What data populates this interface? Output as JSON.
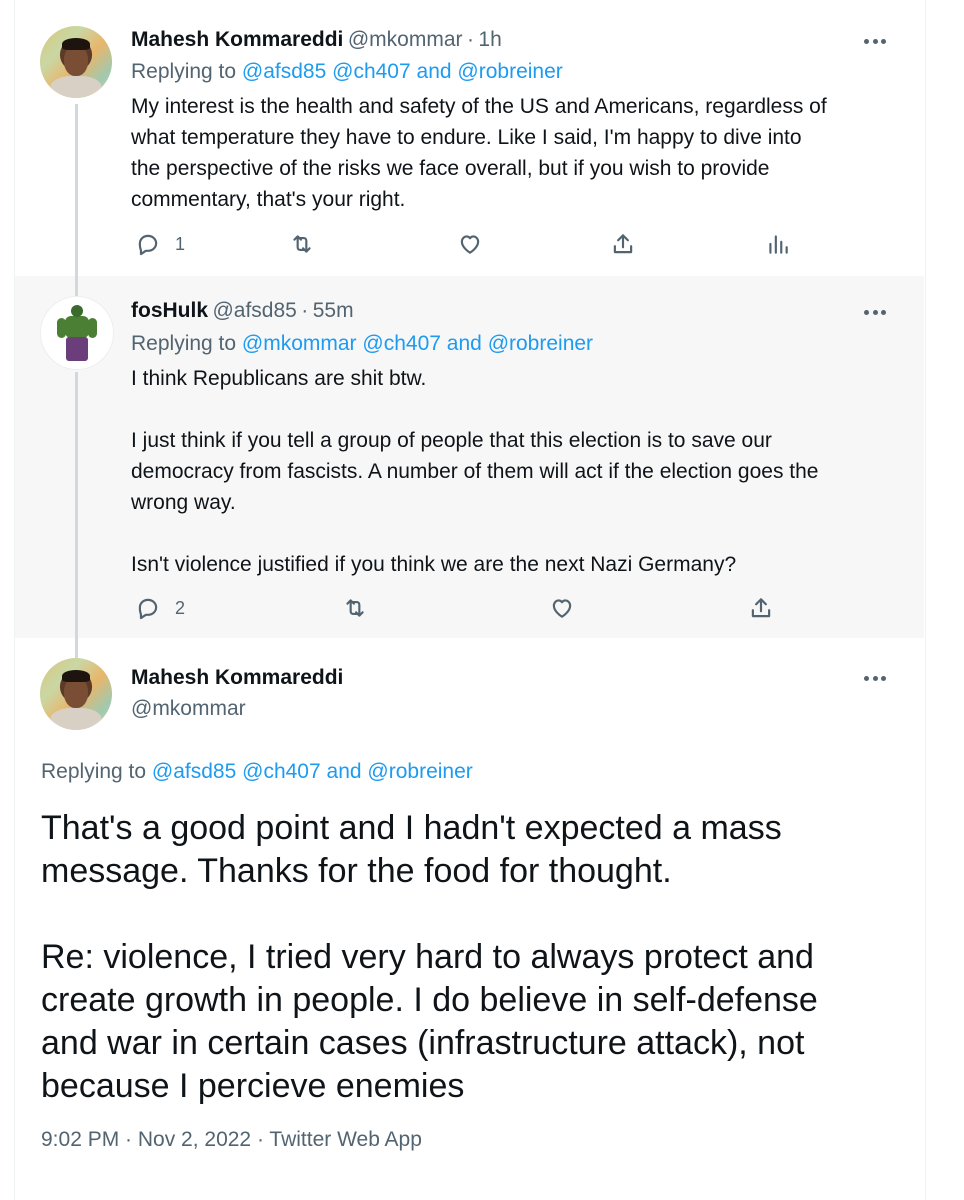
{
  "tweets": [
    {
      "name": "Mahesh Kommareddi",
      "handle": "@mkommar",
      "sep": "·",
      "time": "1h",
      "replying_prefix": "Replying to",
      "replying_to": [
        "@afsd85",
        "@ch407"
      ],
      "replying_and": "and",
      "replying_last": "@robreiner",
      "text": "My interest is the health and safety of the US and Americans, regardless of\nwhat temperature they have to endure. Like I said, I'm happy to dive into\nthe perspective of the risks we face overall, but if you wish to provide\ncommentary, that's your right.",
      "reply_count": "1",
      "icons": [
        "reply-icon",
        "retweet-icon",
        "like-icon",
        "share-icon",
        "analytics-icon"
      ]
    },
    {
      "name": "fosHulk",
      "handle": "@afsd85",
      "sep": "·",
      "time": "55m",
      "replying_prefix": "Replying to",
      "replying_to": [
        "@mkommar",
        "@ch407"
      ],
      "replying_and": "and",
      "replying_last": "@robreiner",
      "text": "I think Republicans are shit btw.\n\nI just think if you tell a group of people that this election is to save our\ndemocracy from fascists. A number of them will act if the election goes the\nwrong way.\n\nIsn't violence justified if you think we are the next Nazi Germany?",
      "reply_count": "2",
      "icons": [
        "reply-icon",
        "retweet-icon",
        "like-icon",
        "share-icon"
      ]
    },
    {
      "name": "Mahesh Kommareddi",
      "handle": "@mkommar",
      "replying_prefix": "Replying to",
      "replying_to": [
        "@afsd85",
        "@ch407"
      ],
      "replying_and": "and",
      "replying_last": "@robreiner",
      "text": "That's a good point and I hadn't expected a mass\nmessage. Thanks for the food for thought.\n\nRe: violence, I tried very hard to always protect and\ncreate growth in people. I do believe in self-defense\nand war in certain cases (infrastructure attack), not\nbecause I percieve enemies",
      "timestamp": "9:02 PM · Nov 2, 2022 · Twitter Web App"
    }
  ],
  "colors": {
    "link": "#1d9bf0",
    "muted": "#536471",
    "text": "#0f1419",
    "highlight_bg": "#f7f7f7"
  }
}
